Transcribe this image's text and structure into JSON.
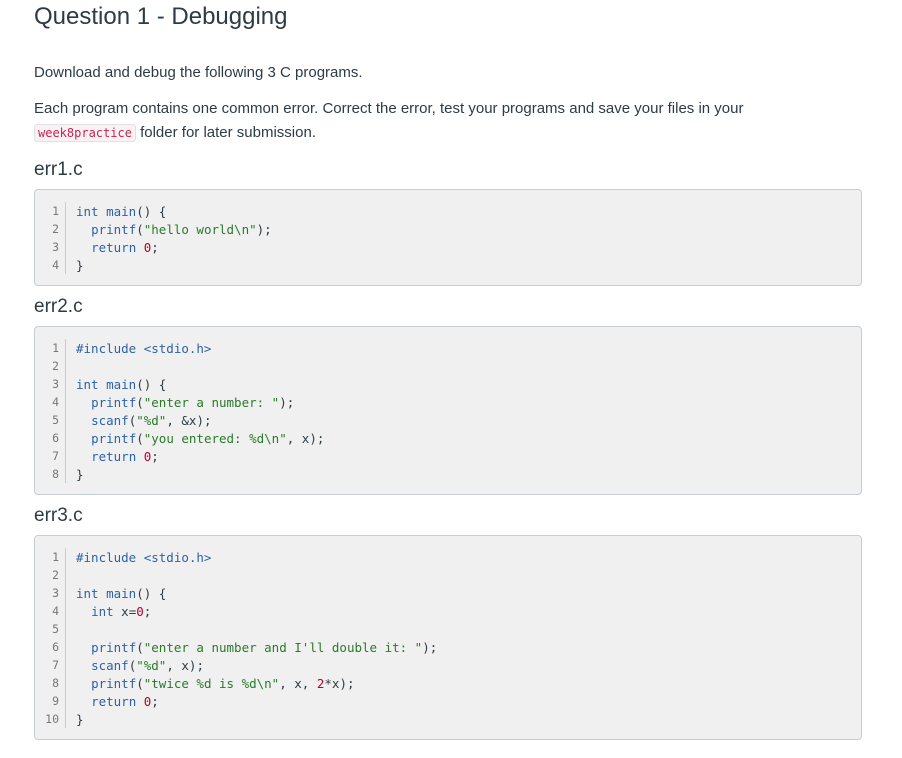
{
  "title": "Question 1 - Debugging",
  "intro": "Download and debug the following 3 C programs.",
  "instruction_part1": "Each program contains one common error. Correct the error, test your programs and save your files in your",
  "folder_code": "week8practice",
  "instruction_part2": " folder for later submission.",
  "files": [
    {
      "name": "err1.c",
      "lines": [
        "int main() {",
        "  printf(\"hello world\\n\");",
        "  return 0;",
        "}"
      ]
    },
    {
      "name": "err2.c",
      "lines": [
        "#include <stdio.h>",
        "",
        "int main() {",
        "  printf(\"enter a number: \");",
        "  scanf(\"%d\", &x);",
        "  printf(\"you entered: %d\\n\", x);",
        "  return 0;",
        "}"
      ]
    },
    {
      "name": "err3.c",
      "lines": [
        "#include <stdio.h>",
        "",
        "int main() {",
        "  int x=0;",
        "",
        "  printf(\"enter a number and I'll double it: \");",
        "  scanf(\"%d\", x);",
        "  printf(\"twice %d is %d\\n\", x, 2*x);",
        "  return 0;",
        "}"
      ]
    }
  ]
}
